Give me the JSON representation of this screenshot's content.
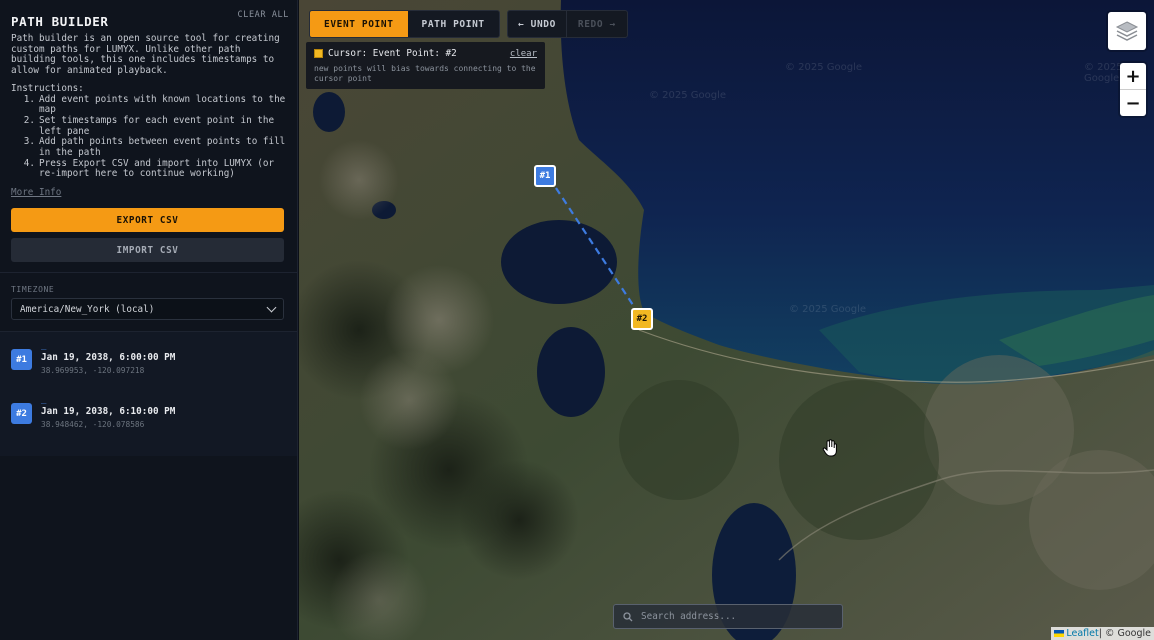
{
  "sidebar": {
    "title": "PATH BUILDER",
    "clear_all": "CLEAR ALL",
    "description": "Path builder is an open source tool for creating custom paths for LUMYX. Unlike other path building tools, this one includes timestamps to allow for animated playback.",
    "instructions_title": "Instructions:",
    "instructions": [
      {
        "n": "1.",
        "text": "Add event points with known locations to the map"
      },
      {
        "n": "2.",
        "text": "Set timestamps for each event point in the left pane"
      },
      {
        "n": "3.",
        "text": "Add path points between event points to fill in the path"
      },
      {
        "n": "4.",
        "text": "Press Export CSV and import into LUMYX (or re-import here to continue working)"
      }
    ],
    "more_info": "More Info",
    "export_label": "EXPORT CSV",
    "import_label": "IMPORT CSV",
    "timezone_label": "TIMEZONE",
    "timezone_value": "America/New_York (local)",
    "events": [
      {
        "badge": "#1",
        "name": "_",
        "time": "Jan 19, 2038, 6:00:00 PM",
        "coords": "38.969953, -120.097218",
        "color": "#3d7be0"
      },
      {
        "badge": "#2",
        "name": "_",
        "time": "Jan 19, 2038, 6:10:00 PM",
        "coords": "38.948462, -120.078586",
        "color": "#3d7be0"
      }
    ]
  },
  "map": {
    "mode_event": "EVENT POINT",
    "mode_path": "PATH POINT",
    "active_mode": "EVENT POINT",
    "undo_label": "← UNDO",
    "redo_label": "REDO →",
    "cursor_title": "Cursor: Event Point: #2",
    "cursor_clear": "clear",
    "cursor_desc": "new points will bias towards connecting to the cursor point",
    "markers": [
      {
        "label": "#1",
        "color": "#3d7be0"
      },
      {
        "label": "#2",
        "color": "#f2b822"
      }
    ],
    "zoom_in": "+",
    "zoom_out": "−",
    "search_placeholder": "Search address...",
    "attribution_leaflet": "Leaflet",
    "attribution_sep": " | © Google",
    "watermarks": [
      "© 2025 Google",
      "© 2025 Google",
      "© 2025 Google",
      "© 2025 Google"
    ],
    "icons": {
      "layers": "layers-icon",
      "search": "search-icon",
      "cursor": "hand-cursor-icon"
    },
    "colors": {
      "accent": "#f59a14",
      "event_blue": "#3d7be0",
      "event_yellow": "#f2b822"
    }
  }
}
